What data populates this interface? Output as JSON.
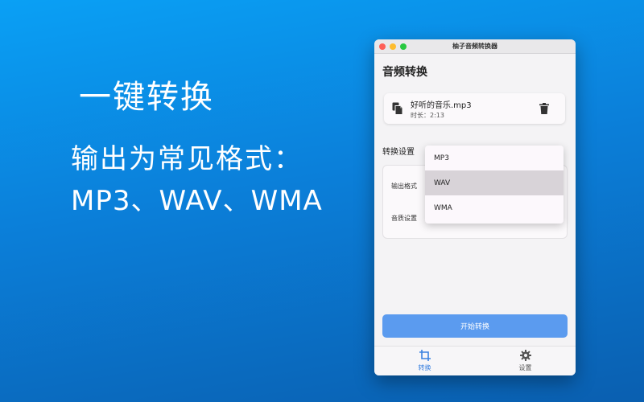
{
  "promo": {
    "title": "一键转换",
    "subtitle_line1": "输出为常见格式：",
    "subtitle_line2": "MP3、WAV、WMA"
  },
  "window": {
    "title": "柚子音频转换器"
  },
  "page": {
    "heading": "音频转换"
  },
  "file": {
    "name": "好听的音乐.mp3",
    "duration": "时长：2:13",
    "icon": "copy-icon",
    "delete_icon": "trash-icon"
  },
  "settings": {
    "section_label": "转换设置",
    "output_format_label": "输出格式",
    "quality_label": "音质设置"
  },
  "format_dropdown": {
    "options": [
      "MP3",
      "WAV",
      "WMA"
    ],
    "selected": "WAV"
  },
  "actions": {
    "start_label": "开始转换"
  },
  "tabs": [
    {
      "label": "转换",
      "icon": "crop-icon",
      "active": true
    },
    {
      "label": "设置",
      "icon": "gear-icon",
      "active": false
    }
  ],
  "colors": {
    "accent": "#5b9bef",
    "active_tab": "#3b82e0",
    "background_top": "#0aa0f5",
    "background_bottom": "#0a5fb0"
  }
}
